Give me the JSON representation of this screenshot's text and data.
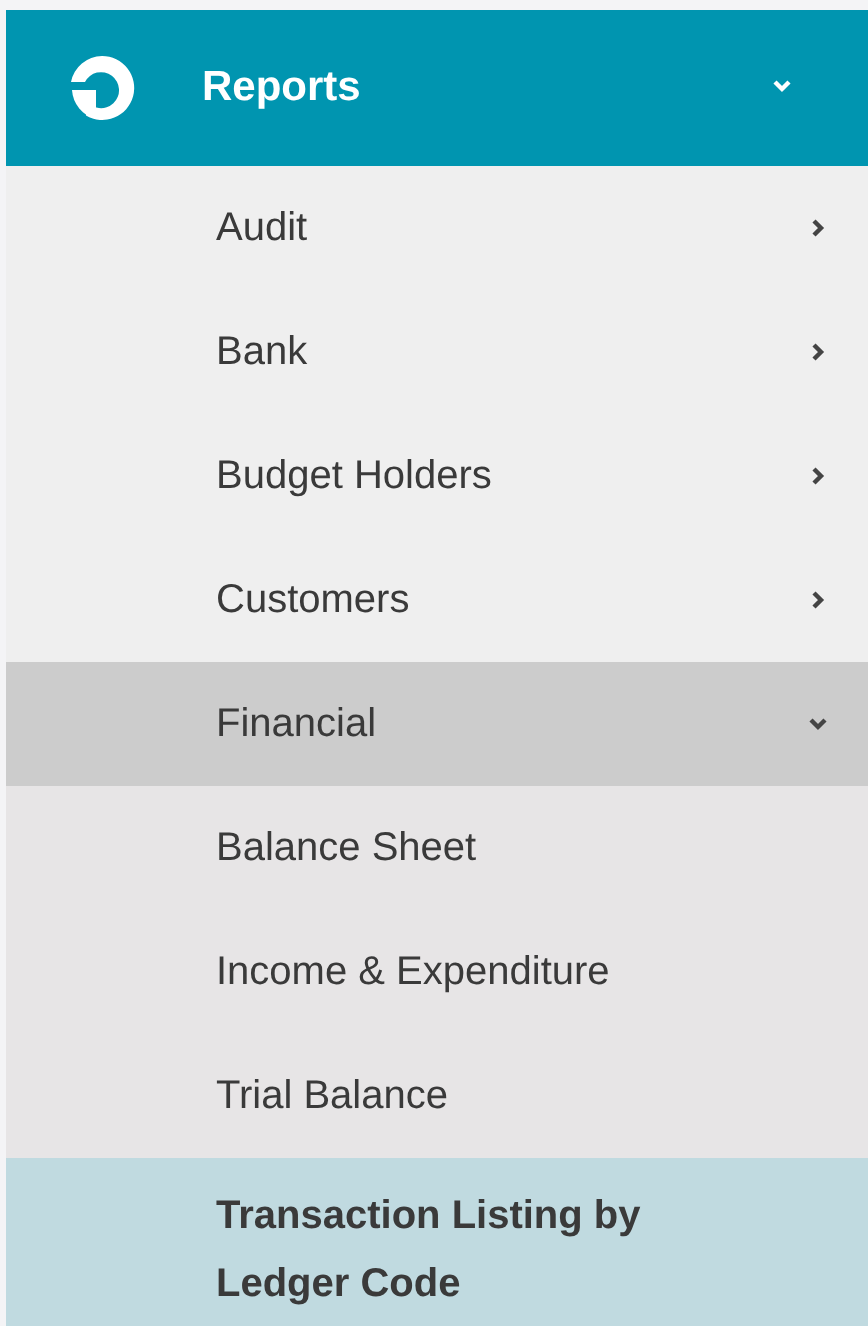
{
  "header": {
    "title": "Reports",
    "expanded": true
  },
  "items": [
    {
      "label": "Audit",
      "expanded": false
    },
    {
      "label": "Bank",
      "expanded": false
    },
    {
      "label": "Budget Holders",
      "expanded": false
    },
    {
      "label": "Customers",
      "expanded": false
    },
    {
      "label": "Financial",
      "expanded": true,
      "children": [
        {
          "label": "Balance Sheet",
          "selected": false
        },
        {
          "label": "Income & Expenditure",
          "selected": false
        },
        {
          "label": "Trial Balance",
          "selected": false
        },
        {
          "label": "Transaction Listing by Ledger Code",
          "selected": true
        }
      ]
    }
  ]
}
